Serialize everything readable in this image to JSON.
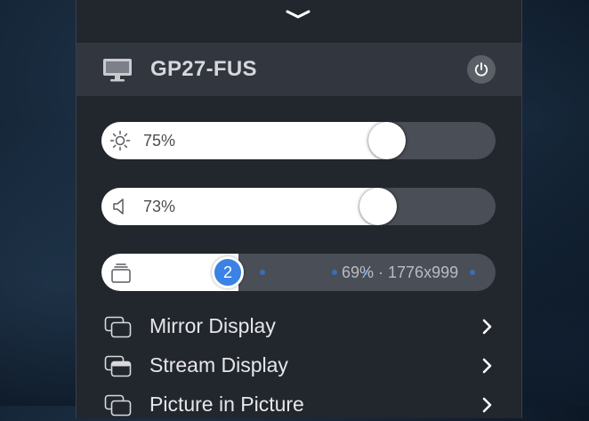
{
  "display": {
    "name": "GP27-FUS"
  },
  "brightness": {
    "value_label": "75%",
    "level": 0.75
  },
  "volume": {
    "value_label": "73%",
    "level": 0.73
  },
  "resolution": {
    "badge": "2",
    "summary": "69% · 1776x999"
  },
  "menu": [
    {
      "label": "Mirror Display",
      "icon": "mirror-display-icon"
    },
    {
      "label": "Stream Display",
      "icon": "stream-display-icon"
    },
    {
      "label": "Picture in Picture",
      "icon": "picture-in-picture-icon"
    }
  ]
}
